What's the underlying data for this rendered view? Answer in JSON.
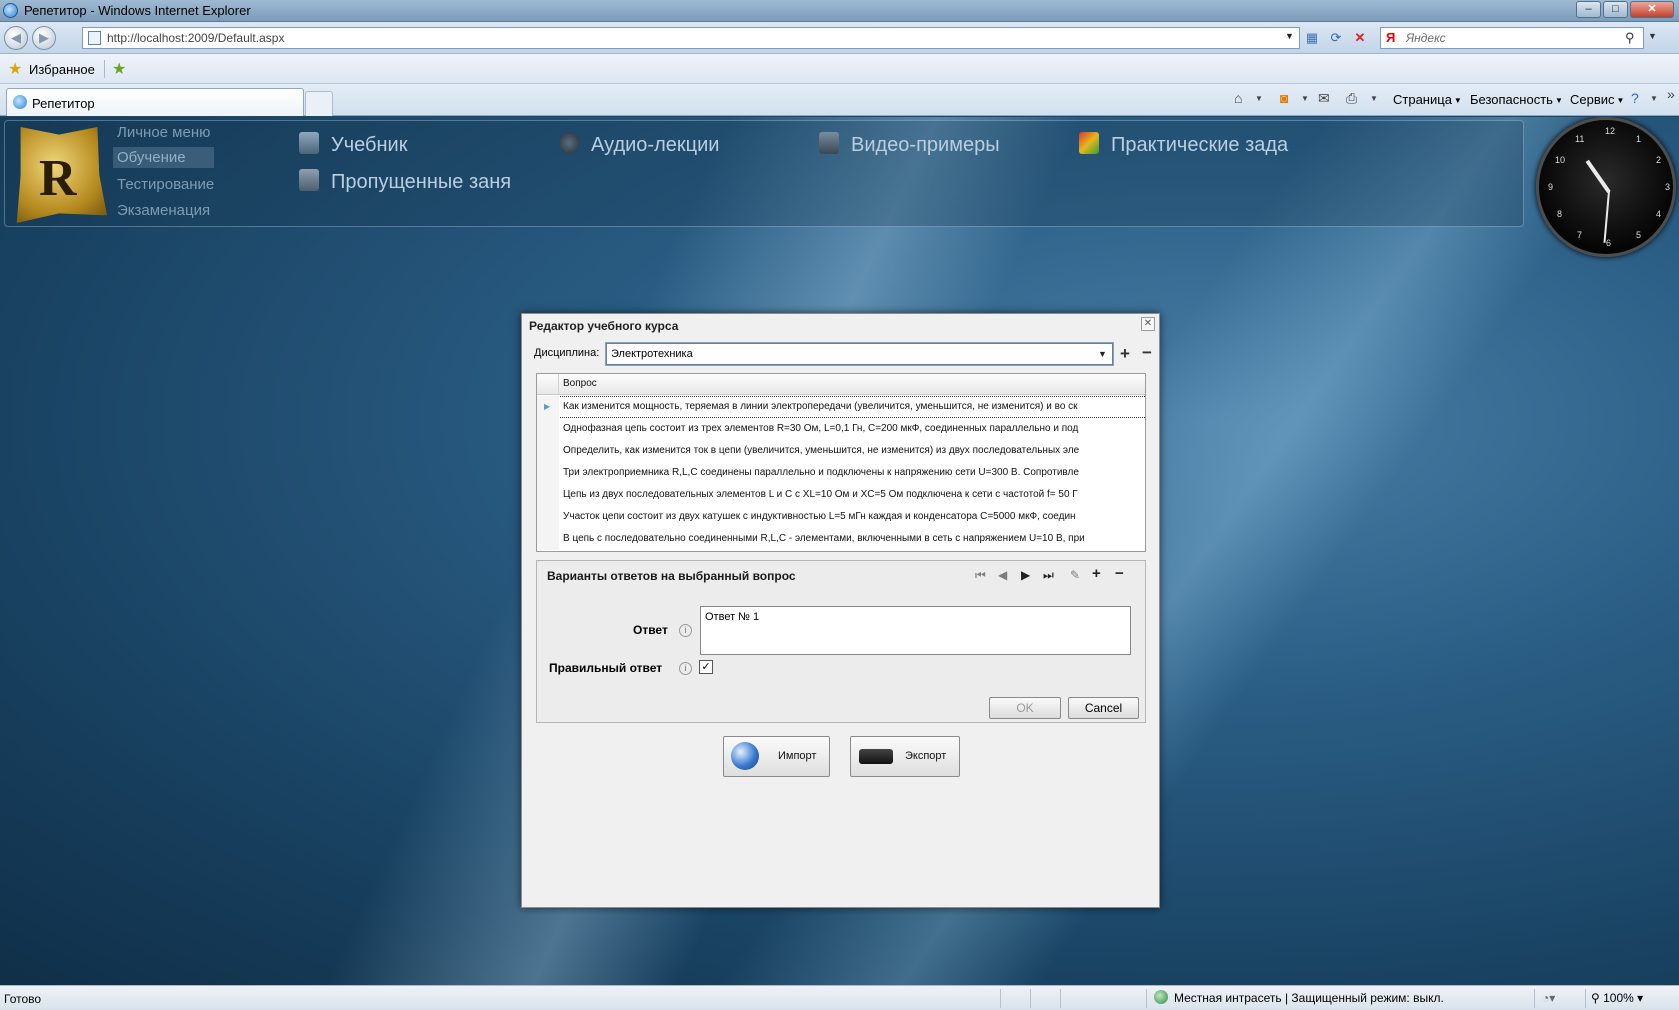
{
  "window": {
    "title": "Репетитор - Windows Internet Explorer"
  },
  "nav": {
    "url": "http://localhost:2009/Default.aspx",
    "search_placeholder": "Яндекс"
  },
  "favorites": {
    "label": "Избранное"
  },
  "tabs": [
    {
      "label": "Репетитор"
    }
  ],
  "commandbar": {
    "page": "Страница",
    "security": "Безопасность",
    "service": "Сервис"
  },
  "app": {
    "left_menu": [
      "Личное меню",
      "Обучение",
      "Тестирование",
      "Экзаменация"
    ],
    "top_items": [
      "Учебник",
      "Аудио-лекции",
      "Видео-примеры",
      "Практические зада",
      "Пропущенные заня"
    ],
    "clock": {
      "numbers": [
        "12",
        "1",
        "2",
        "3",
        "4",
        "5",
        "6",
        "7",
        "8",
        "9",
        "10",
        "11"
      ]
    }
  },
  "dialog": {
    "title": "Редактор учебного курса",
    "discipline_label": "Дисциплина:",
    "discipline_value": "Электротехника",
    "grid_header": "Вопрос",
    "questions": [
      "Как изменится  мощность, теряемая в линии электропередачи (увеличится, уменьшится, не изменится) и во ск",
      "Однофазная цепь состоит из трех элементов R=30 Ом, L=0,1 Гн, C=200 мкФ, соединенных параллельно и под",
      "Определить, как изменится ток в цепи (увеличится, уменьшится, не изменится) из двух последовательных эле",
      "Три электроприемника R,L,C соединены параллельно и подключены к напряжению сети U=300 В. Сопротивле",
      "Цепь из двух последовательных элементов L и C с  XL=10 Ом и XC=5 Ом подключена к сети с частотой f= 50 Г",
      "Участок цепи состоит из двух катушек с индуктивностью L=5 мГн каждая и конденсатора C=5000 мкФ, соедин",
      "В цепь с последовательно соединенными R,L,C - элементами, включенными в сеть с напряжением U=10 В, при"
    ],
    "answers": {
      "title": "Варианты ответов на выбранный вопрос",
      "answer_label": "Ответ",
      "answer_value": "Ответ № 1",
      "correct_label": "Правильный ответ",
      "correct_checked": true,
      "ok": "OK",
      "cancel": "Cancel"
    },
    "import": "Импорт",
    "export": "Экспорт"
  },
  "status": {
    "text": "Готово",
    "zone": "Местная интрасеть | Защищенный режим: выкл.",
    "zoom": "100%"
  }
}
